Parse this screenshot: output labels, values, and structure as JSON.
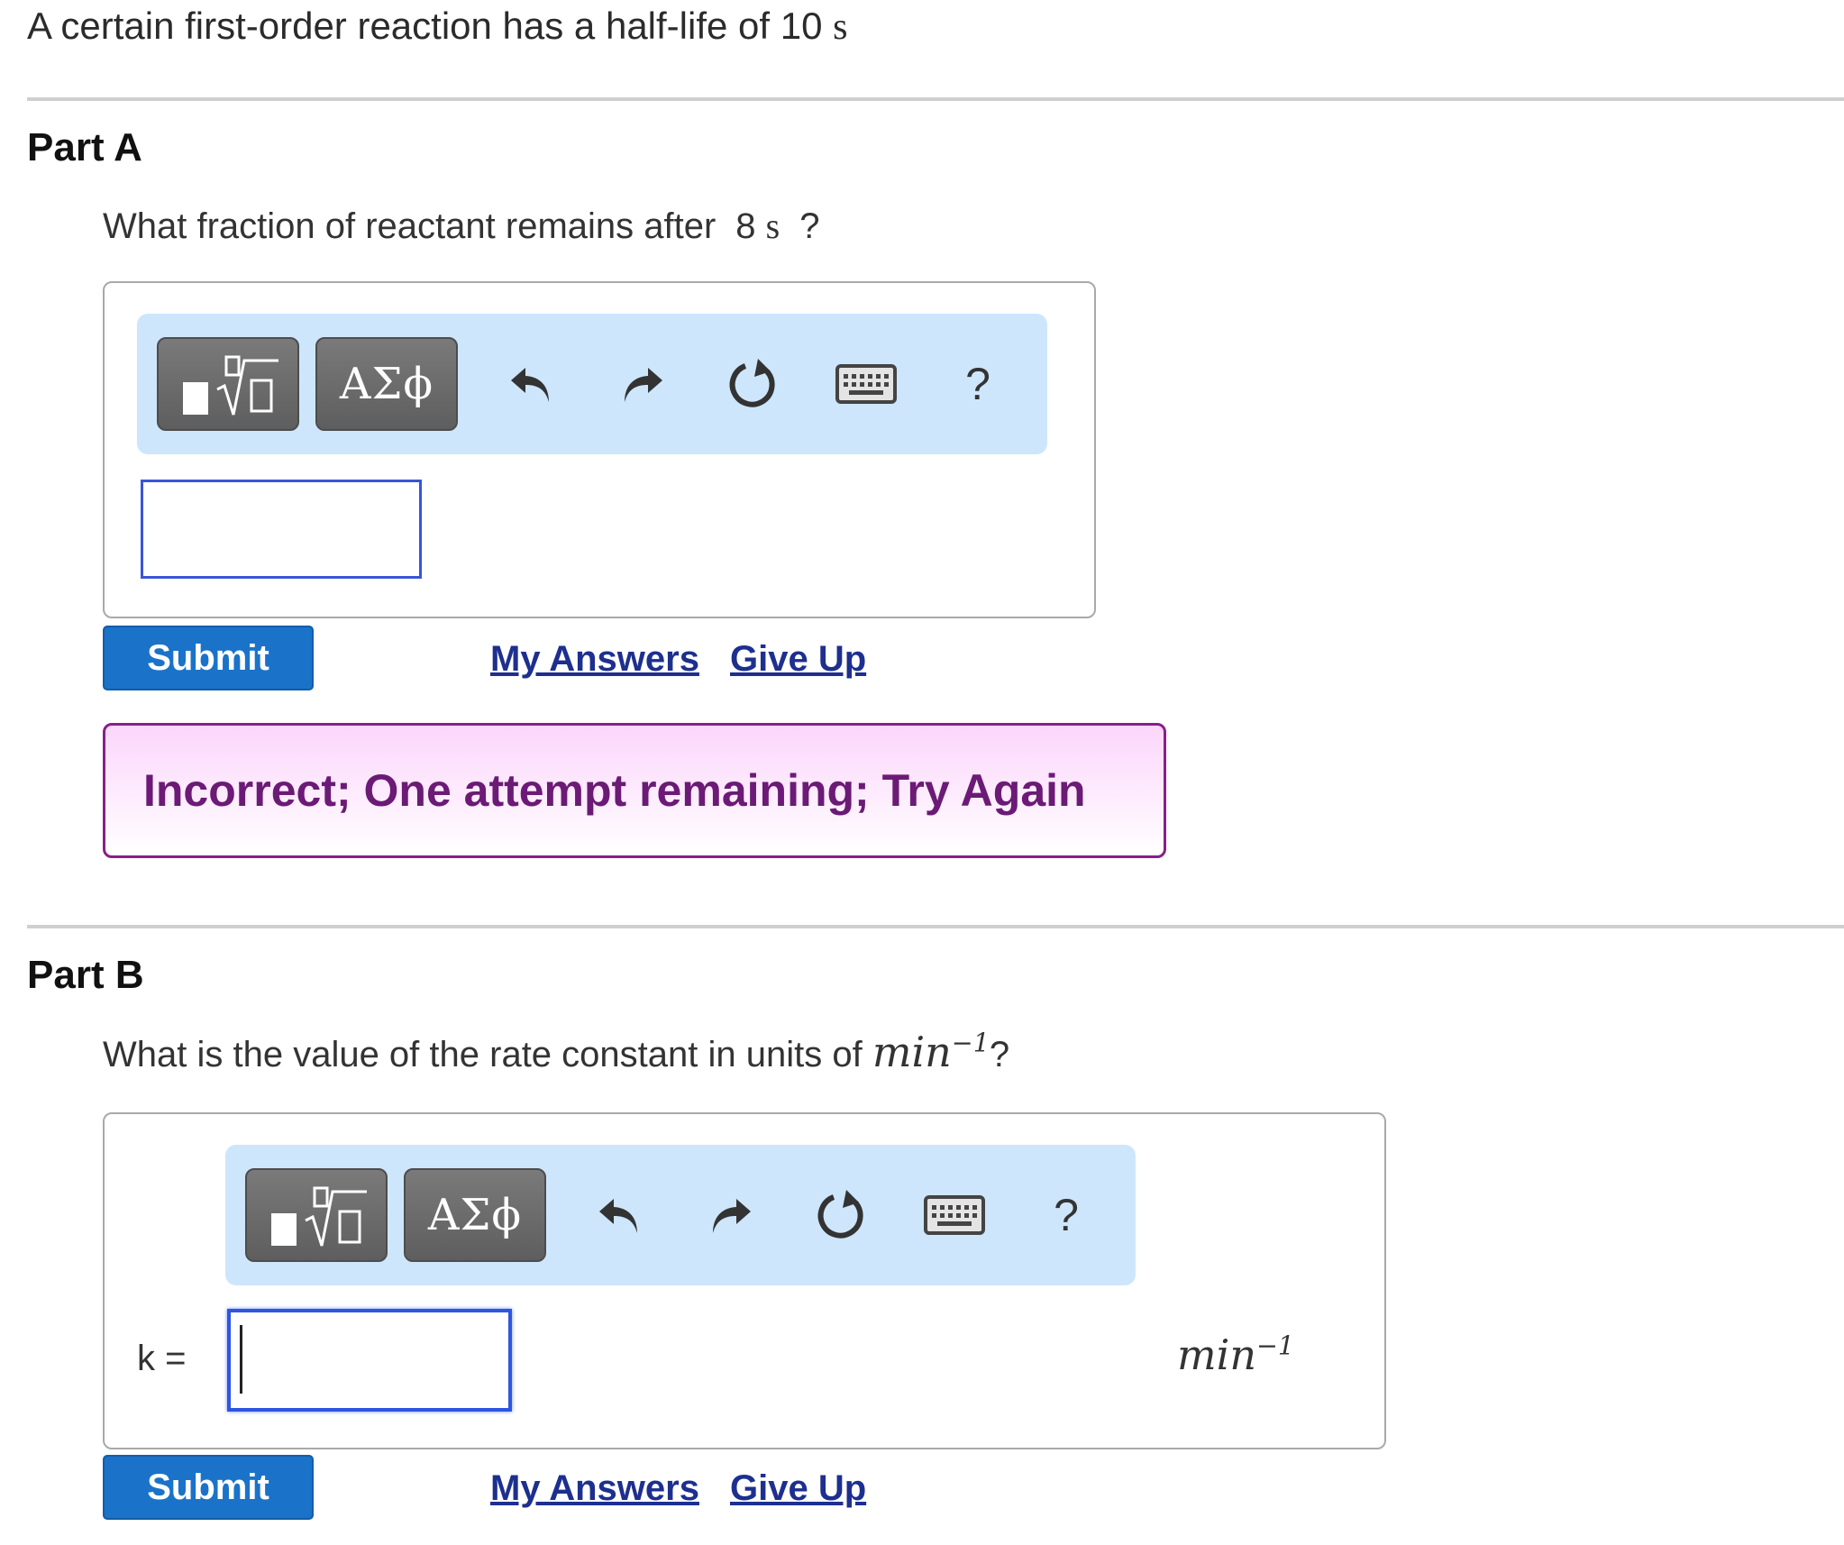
{
  "intro": {
    "text": "A certain first-order reaction has a half-life of 10",
    "unit": "s"
  },
  "part_a": {
    "title": "Part A",
    "question_prefix": "What fraction of reactant remains after",
    "question_value": "8",
    "question_unit": "s",
    "question_suffix": "?",
    "toolbar": {
      "templates_icon": "templates-radical-icon",
      "greek_label": "ΑΣϕ",
      "undo_icon": "undo-icon",
      "redo_icon": "redo-icon",
      "reset_icon": "reset-icon",
      "keyboard_icon": "keyboard-icon",
      "help_label": "?"
    },
    "answer_value": "",
    "submit_label": "Submit",
    "my_answers_label": "My Answers",
    "give_up_label": "Give Up",
    "feedback": "Incorrect; One attempt remaining; Try Again"
  },
  "part_b": {
    "title": "Part B",
    "question_prefix": "What is the value of the rate constant in units of",
    "question_unit_base": "min",
    "question_unit_exp": "−1",
    "question_suffix": "?",
    "toolbar": {
      "templates_icon": "templates-radical-icon",
      "greek_label": "ΑΣϕ",
      "undo_icon": "undo-icon",
      "redo_icon": "redo-icon",
      "reset_icon": "reset-icon",
      "keyboard_icon": "keyboard-icon",
      "help_label": "?"
    },
    "answer_label": "k =",
    "answer_value": "",
    "unit_base": "min",
    "unit_exp": "−1",
    "submit_label": "Submit",
    "my_answers_label": "My Answers",
    "give_up_label": "Give Up"
  },
  "colors": {
    "submit": "#1a73c9",
    "link": "#1d2f8f",
    "feedback_border": "#8a1e8a",
    "feedback_text": "#6b1a76",
    "toolbar_bg": "#cde6fb"
  }
}
